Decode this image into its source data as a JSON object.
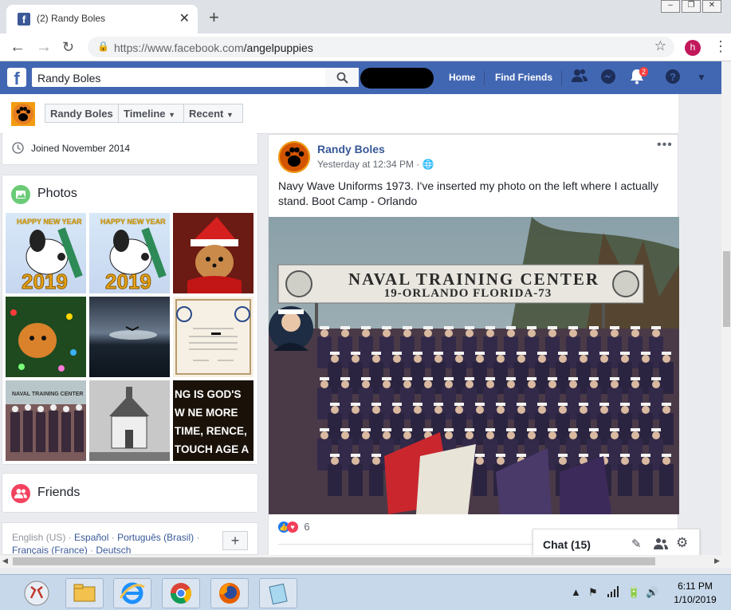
{
  "browser": {
    "tab_title": "(2) Randy Boles",
    "tab_favicon": "f",
    "url_domain": "https://www.facebook.com",
    "url_path": "/angelpuppies",
    "profile_initial": "h"
  },
  "fb": {
    "search_value": "Randy Boles",
    "nav_home": "Home",
    "nav_find_friends": "Find Friends",
    "notification_count": "2",
    "brand_color": "#4267b2"
  },
  "profile_header": {
    "name_tab": "Randy Boles",
    "timeline_tab": "Timeline",
    "recent_tab": "Recent"
  },
  "intro": {
    "joined": "Joined November 2014"
  },
  "photos": {
    "title": "Photos",
    "tile_text_1": "HAPPY NEW YEAR",
    "tile_text_2": "HAPPY NEW YEAR",
    "tile_text_7": "NAVAL TRAINING CENTER",
    "tile_text_9": "NG IS GOD'S W NE MORE TIME, RENCE, TOUCH AGE A MIND, IN AND ENJOY TH"
  },
  "friends": {
    "title": "Friends"
  },
  "footer": {
    "lang_en": "English (US)",
    "lang_es": "Español",
    "lang_pt": "Português (Brasil)",
    "lang_fr": "Français (France)",
    "lang_de": "Deutsch",
    "add_language": "+"
  },
  "post": {
    "author": "Randy Boles",
    "time": "Yesterday at 12:34 PM",
    "text": "Navy Wave Uniforms 1973. I've inserted my photo on the left where I actually stand. Boot Camp - Orlando",
    "banner_line1": "NAVAL TRAINING CENTER",
    "banner_line2": "19-ORLANDO FLORIDA-73",
    "reaction_count": "6"
  },
  "chat": {
    "label": "Chat (15)"
  },
  "taskbar": {
    "time": "6:11 PM",
    "date": "1/10/2019"
  }
}
